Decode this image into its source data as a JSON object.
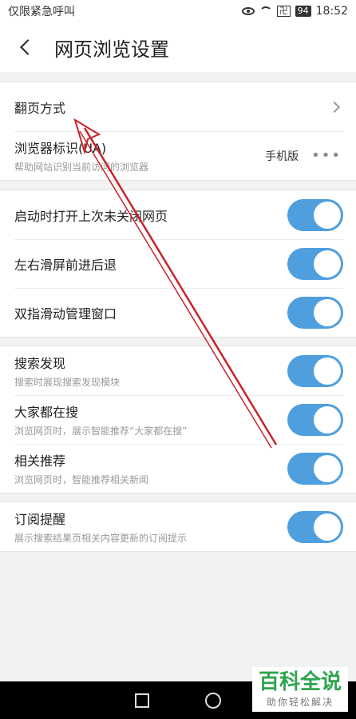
{
  "status_bar": {
    "left_text": "仅限紧急呼叫",
    "signal": "卍",
    "battery": "94",
    "time": "18:52"
  },
  "header": {
    "title": "网页浏览设置"
  },
  "groups": [
    {
      "items": [
        {
          "label": "翻页方式",
          "control": "chevron"
        },
        {
          "label": "浏览器标识(UA)",
          "sub": "帮助网站识别当前访问的浏览器",
          "value": "手机版",
          "more": "•••"
        }
      ]
    },
    {
      "items": [
        {
          "label": "启动时打开上次未关闭网页",
          "toggle": true
        },
        {
          "label": "左右滑屏前进后退",
          "toggle": true
        },
        {
          "label": "双指滑动管理窗口",
          "toggle": true
        }
      ]
    },
    {
      "items": [
        {
          "label": "搜索发现",
          "sub": "搜索时展现搜索发现模块",
          "toggle": true
        },
        {
          "label": "大家都在搜",
          "sub": "浏览网页时，展示智能推荐“大家都在搜”",
          "toggle": true
        },
        {
          "label": "相关推荐",
          "sub": "浏览网页时，智能推荐相关新闻",
          "toggle": true
        }
      ]
    },
    {
      "items": [
        {
          "label": "订阅提醒",
          "sub": "展示搜索结果页相关内容更新的订阅提示",
          "toggle": true
        }
      ]
    }
  ],
  "watermark": {
    "main": "百科全说",
    "sub": "助你轻松解决"
  },
  "colors": {
    "toggle_on": "#4f9fde",
    "annotation_arrow": "#c8232c",
    "watermark_green": "#2fa44f"
  }
}
